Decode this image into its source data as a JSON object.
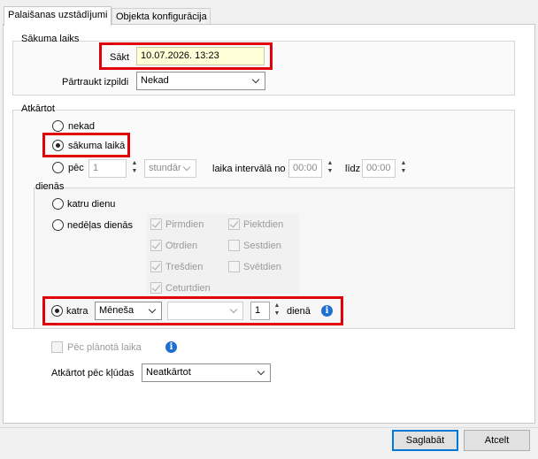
{
  "tabs": [
    {
      "label": "Palaišanas uzstādījumi",
      "active": true
    },
    {
      "label": "Objekta konfigurācija",
      "active": false
    }
  ],
  "start_group": {
    "title": "Sākuma laiks",
    "start_label": "Sākt",
    "start_value": "10.07.2026. 13:23",
    "stop_label": "Pārtraukt izpildi",
    "stop_value": "Nekad"
  },
  "repeat_group": {
    "title": "Atkārtot",
    "options": {
      "never": "nekad",
      "at_start": "sākuma laikā",
      "after": "pēc"
    },
    "after_value": "1",
    "after_unit": "stundār",
    "interval_label": "laika intervālā no",
    "from_value": "00:00",
    "to_label": "līdz",
    "to_value": "00:00"
  },
  "days_group": {
    "title": "dienās",
    "every_day": "katru dienu",
    "weekdays_label": "nedēļas dienās",
    "weekdays": [
      {
        "label": "Pirmdien",
        "checked": true
      },
      {
        "label": "Otrdien",
        "checked": true
      },
      {
        "label": "Trešdien",
        "checked": true
      },
      {
        "label": "Ceturtdien",
        "checked": true
      },
      {
        "label": "Piektdien",
        "checked": true
      },
      {
        "label": "Sestdien",
        "checked": false
      },
      {
        "label": "Svētdien",
        "checked": false
      }
    ],
    "each_label": "katra",
    "each_period": "Mēneša",
    "each_second": "",
    "each_day_value": "1",
    "day_label": "dienā"
  },
  "after_planned_label": "Pēc plānotā laika",
  "retry_label": "Atkārtot pēc kļūdas",
  "retry_value": "Neatkārtot",
  "buttons": {
    "save": "Saglabāt",
    "cancel": "Atcelt"
  },
  "colors": {
    "highlight": "#e0000a",
    "info": "#1e6fd0",
    "accent": "#0078d7"
  },
  "icons": [
    "info-icon",
    "chevron-down-icon",
    "spin-up-icon",
    "spin-down-icon"
  ]
}
